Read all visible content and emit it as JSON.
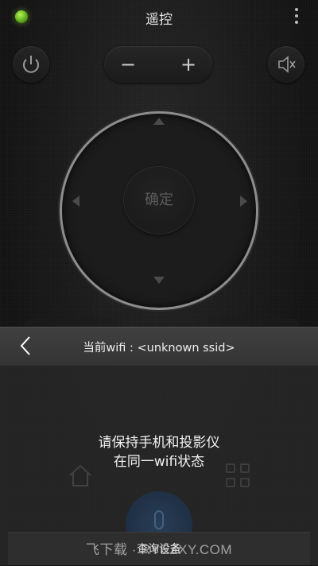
{
  "header": {
    "title": "遥控",
    "status_color": "#7ccd2a"
  },
  "controls": {
    "power_icon": "power-icon",
    "volume_minus": "−",
    "volume_plus": "+",
    "mute_icon": "mute-icon",
    "ok_label": "确定"
  },
  "panel": {
    "title": "当前wifi : <unknown ssid>",
    "message_line1": "请保持手机和投影仪",
    "message_line2": "在同一wifi状态",
    "search_label": "查询设备"
  },
  "watermark": "飞下载 · RYEZXY.COM"
}
